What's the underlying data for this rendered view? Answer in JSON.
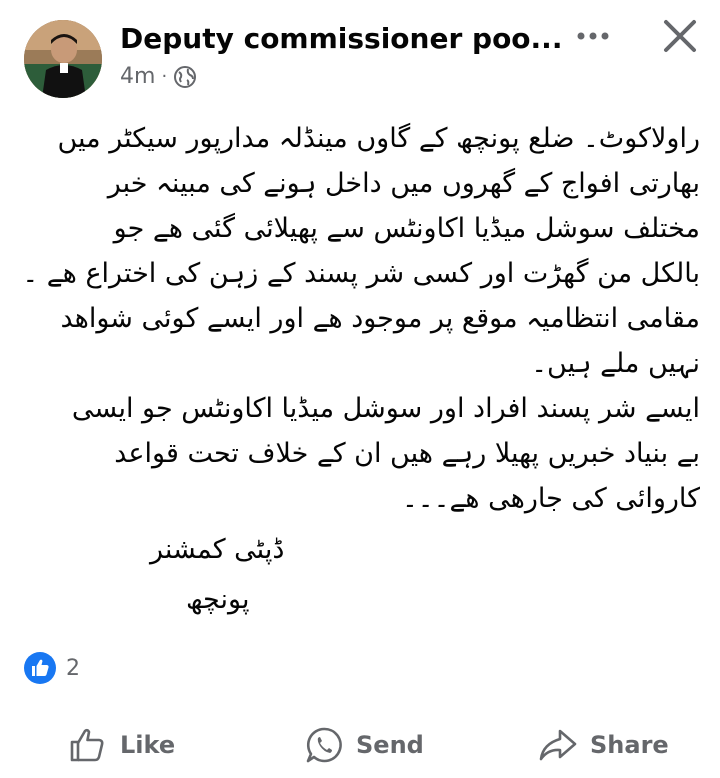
{
  "post": {
    "author": "Deputy commissioner poo...",
    "time": "4m",
    "separator": "·",
    "body_lines": [
      "راولاکوٹ۔ ضلع پونچھ کے گاوں مینڈلہ مدارپور سیکٹر میں",
      "بھارتی افواج کے گھروں میں داخل ہونے کی مبینہ خبر",
      "مختلف سوشل میڈیا اکاونٹس سے پھیلائی گئی ھے جو",
      "بالکل من گھڑت اور کسی شر پسند کے زہن کی اختراع ھے ۔",
      "مقامی انتظامیہ موقع پر موجود ھے اور ایسے کوئی شواھد",
      "نہیں ملے ہیں۔",
      "ایسے شر پسند افراد اور سوشل میڈیا اکاونٹس جو ایسی",
      "بے بنیاد خبریں پھیلا رہے ھیں ان کے خلاف تحت قواعد",
      "کاروائی کی جارھی ھے۔۔۔"
    ],
    "signature_title": "ڈپٹی کمشنر",
    "signature_place": "پونچھ",
    "reaction_count": "2"
  },
  "actions": {
    "like_label": "Like",
    "send_label": "Send",
    "share_label": "Share"
  },
  "icons": {
    "more": "more-dots-icon",
    "close": "close-icon",
    "privacy": "globe-icon",
    "reaction": "like-reaction-icon",
    "like": "thumbs-up-icon",
    "send": "whatsapp-icon",
    "share": "share-arrow-icon"
  },
  "colors": {
    "text": "#050505",
    "secondary": "#65676b",
    "like_blue": "#1877f2"
  }
}
